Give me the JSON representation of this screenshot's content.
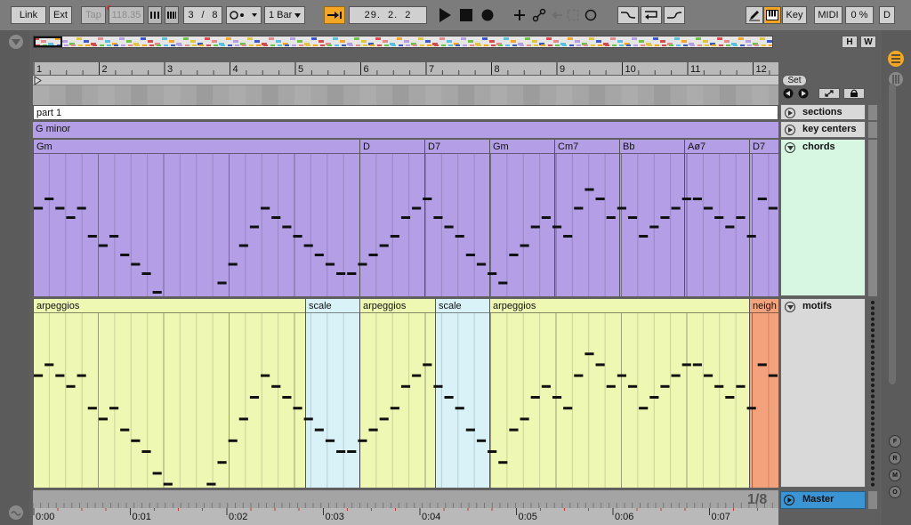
{
  "toolbar": {
    "link": "Link",
    "ext": "Ext",
    "tap": "Tap",
    "tempo": "118.35",
    "signature_num": "3",
    "signature_sep": "/",
    "signature_den": "8",
    "quantize": "1 Bar",
    "position": "29.  2.  2",
    "key": "Key",
    "midi": "MIDI",
    "cpu": "0 %",
    "d": "D"
  },
  "overview": {
    "h": "H",
    "w": "W"
  },
  "ruler": {
    "bars": [
      "1",
      "2",
      "3",
      "4",
      "5",
      "6",
      "7",
      "8",
      "9",
      "10",
      "11",
      "12"
    ]
  },
  "sections": {
    "clip_label": "part 1",
    "header": "sections"
  },
  "key_centers": {
    "clip_label": "G minor",
    "header": "key centers"
  },
  "chords": {
    "header": "chords",
    "clips": [
      "Gm",
      "D",
      "D7",
      "Gm",
      "Cm7",
      "Bb",
      "Aø7",
      "D7"
    ]
  },
  "motifs": {
    "header": "motifs",
    "clips": [
      "arpeggios",
      "scale",
      "arpeggios",
      "scale",
      "arpeggios",
      "neigh"
    ]
  },
  "set": {
    "label": "Set"
  },
  "master": {
    "label": "Master"
  },
  "zoom": {
    "label": "1/8"
  },
  "timeline": {
    "labels": [
      "0:00",
      "0:01",
      "0:02",
      "0:03",
      "0:04",
      "0:05",
      "0:06",
      "0:07"
    ]
  },
  "side": {
    "f": "F",
    "r": "R",
    "m": "M",
    "o": "O"
  },
  "colors": {
    "accent": "#f5a623",
    "chords": "#b49ee6",
    "motifs_arp": "#eef8b3",
    "motifs_scale": "#d9f2f8",
    "motifs_neigh": "#f3a27b",
    "master": "#3a95d4",
    "chord_header": "#d8f7e3"
  }
}
